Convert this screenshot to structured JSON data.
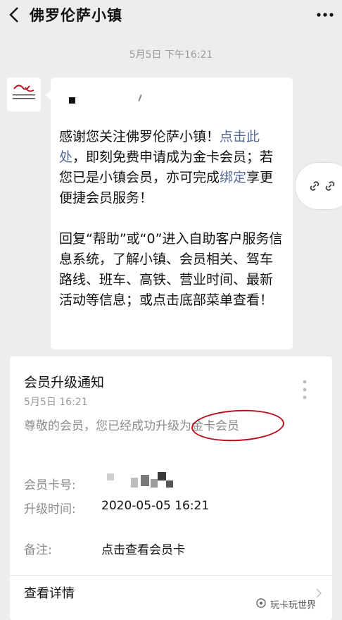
{
  "header": {
    "title": "佛罗伦萨小镇",
    "back_icon": "chevron-left-icon",
    "more_icon": "more-horizontal-icon"
  },
  "chat": {
    "timestamp": "5月5日 下午16:21",
    "avatar_icon": "florentia-village-logo",
    "paragraph1": {
      "text_a": "感谢您关注佛罗伦萨小镇！",
      "link_a": "点击此处",
      "text_b": "，即刻免费申请成为金卡会员；若您已是小镇会员，亦可完成",
      "link_b": "绑定",
      "text_c": "享更便捷会员服务！"
    },
    "paragraph2": "回复“帮助”或“0”进入自助客户服务信息系统，了解小镇、会员相关、驾车路线、班车、高铁、营业时间、最新活动等信息；或点击底部菜单查看！",
    "link_float_icon": "link-icon"
  },
  "card": {
    "title": "会员升级通知",
    "date": "5月5日 16:21",
    "message": "尊敬的会员，您已经成功升级为金卡会员",
    "fields": [
      {
        "label": "会员卡号:",
        "value": ""
      },
      {
        "label": "升级时间:",
        "value": "2020-05-05 16:21"
      },
      {
        "label": "备注:",
        "value": "点击查看会员卡"
      }
    ],
    "details_label": "查看详情",
    "more_icon": "more-vertical-icon",
    "details_icon": "chevron-right-icon"
  },
  "watermark": {
    "text": "玩卡玩世界",
    "icon": "wechat-moments-icon"
  },
  "colors": {
    "background": "#ededed",
    "link": "#576b95",
    "highlight": "#b8111d"
  }
}
